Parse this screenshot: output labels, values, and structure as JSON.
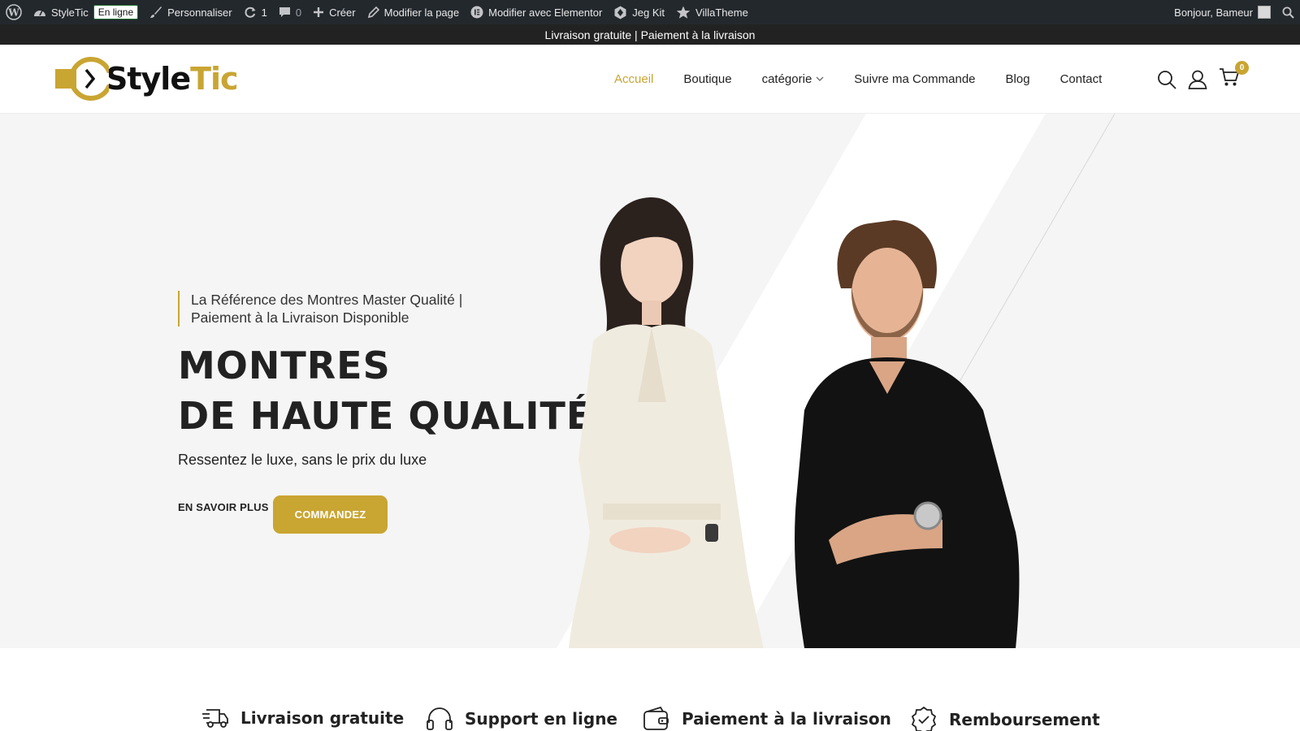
{
  "admin_bar": {
    "wp_icon": "wordpress-icon",
    "site_name": "StyleTic",
    "site_status": "En ligne",
    "customize": "Personnaliser",
    "updates_count": "1",
    "comments_count": "0",
    "create": "Créer",
    "edit_page": "Modifier la page",
    "edit_elementor": "Modifier avec Elementor",
    "jeg_kit": "Jeg Kit",
    "villatheme": "VillaTheme",
    "greeting": "Bonjour, Bameur"
  },
  "promo_strip": {
    "text": "Livraison gratuite | Paiement à la livraison"
  },
  "header": {
    "logo": {
      "part_dark": "Style",
      "part_gold": "Tic"
    },
    "nav": [
      {
        "label": "Accueil",
        "active": true
      },
      {
        "label": "Boutique"
      },
      {
        "label": "catégorie",
        "dropdown": true
      },
      {
        "label": "Suivre ma Commande"
      },
      {
        "label": "Blog"
      },
      {
        "label": "Contact"
      }
    ],
    "cart_count": "0"
  },
  "hero": {
    "tagline": "La Référence des Montres Master Qualité | Paiement à la Livraison Disponible",
    "title_line1": "MONTRES",
    "title_line2": "DE HAUTE QUALITÉ",
    "subtitle": "Ressentez le luxe, sans le prix du luxe",
    "btn_more": "EN SAVOIR PLUS",
    "btn_order": "COMMANDEZ",
    "image": "models-woman-and-man-wearing-watches"
  },
  "features": [
    {
      "label": "Livraison gratuite",
      "icon": "truck-icon"
    },
    {
      "label": "Support en ligne",
      "icon": "headset-icon"
    },
    {
      "label": "Paiement à la livraison",
      "icon": "wallet-icon"
    },
    {
      "label": "Remboursement",
      "icon": "badge-check-icon"
    }
  ],
  "colors": {
    "accent": "#c9a532",
    "admin_bar": "#23282d",
    "promo": "#222222",
    "hero_bg": "#f5f5f5",
    "text": "#222222"
  }
}
